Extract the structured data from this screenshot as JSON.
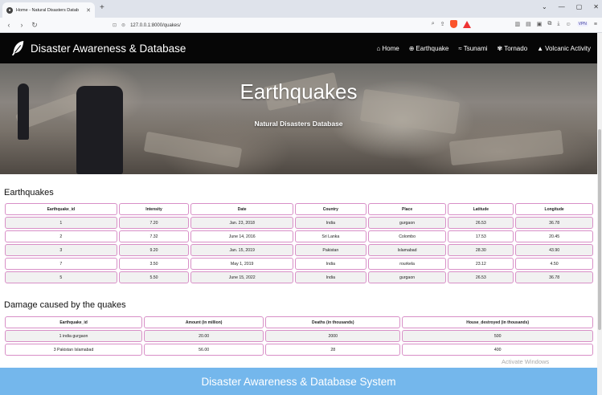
{
  "browser": {
    "tab_title": "Home - Natural Disasters Datab",
    "url": "127.0.0.1:8000/quakes/",
    "vpn_label": "VPN"
  },
  "navbar": {
    "brand": "Disaster Awareness & Database",
    "links": [
      {
        "label": "Home",
        "icon": "home-icon"
      },
      {
        "label": "Earthquake",
        "icon": "globe-icon"
      },
      {
        "label": "Tsunami",
        "icon": "wave-icon"
      },
      {
        "label": "Tornado",
        "icon": "tornado-icon"
      },
      {
        "label": "Volcanic Activity",
        "icon": "volcano-icon"
      }
    ]
  },
  "hero": {
    "title": "Earthquakes",
    "subtitle": "Natural Disasters Database"
  },
  "earthquakes": {
    "heading": "Earthquakes",
    "columns": [
      "Earthquake_id",
      "Intensity",
      "Date",
      "Country",
      "Place",
      "Latitude",
      "Longitude"
    ],
    "rows": [
      [
        "1",
        "7.20",
        "Jan. 23, 2018",
        "India",
        "gurgaon",
        "26.53",
        "36.78"
      ],
      [
        "2",
        "7.32",
        "June 14, 2016",
        "Sri Lanka",
        "Colombo",
        "17.53",
        "20.45"
      ],
      [
        "3",
        "9.20",
        "Jan. 15, 2019",
        "Pakistan",
        "Islamabad",
        "28.30",
        "43.90"
      ],
      [
        "7",
        "3.50",
        "May 1, 2019",
        "India",
        "rourkela",
        "23.12",
        "4.50"
      ],
      [
        "5",
        "5.50",
        "June 15, 2022",
        "India",
        "gurgaon",
        "26.53",
        "36.78"
      ]
    ]
  },
  "damage": {
    "heading": "Damage caused by the quakes",
    "columns": [
      "Earthquake_id",
      "Amount (in million)",
      "Deaths (in thousands)",
      "House_destroyed (in thousands)"
    ],
    "rows": [
      [
        "1 india gurgaon",
        "20.00",
        "2000",
        "500"
      ],
      [
        "3 Pakistan Islamabad",
        "56.00",
        "28",
        "400"
      ]
    ]
  },
  "footer": {
    "text": "Disaster Awareness & Database System"
  },
  "watermark": "Activate Windows"
}
